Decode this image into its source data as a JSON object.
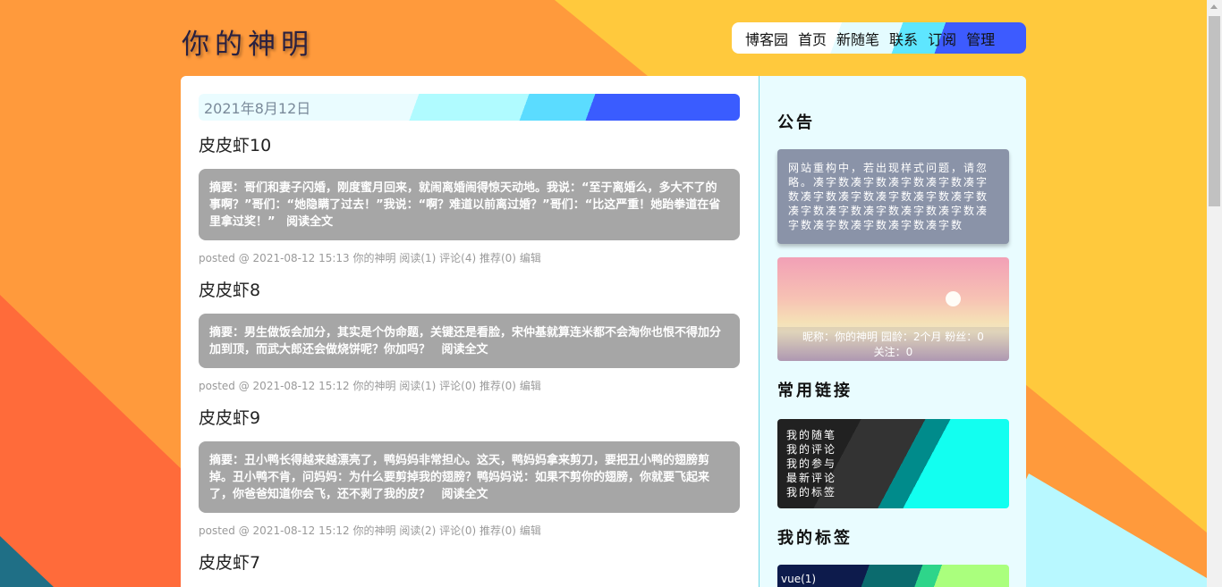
{
  "site": {
    "title": "你的神明"
  },
  "nav": {
    "items": [
      {
        "label": "博客园"
      },
      {
        "label": "首页"
      },
      {
        "label": "新随笔"
      },
      {
        "label": "联系"
      },
      {
        "label": "订阅"
      },
      {
        "label": "管理"
      }
    ]
  },
  "main": {
    "date": "2021年8月12日",
    "read_more_label": "阅读全文",
    "posts": [
      {
        "title": "皮皮虾10",
        "summary": "摘要：哥们和妻子闪婚，刚度蜜月回来，就闹离婚闹得惊天动地。我说：“至于离婚么，多大不了的事啊？”哥们：“她隐瞒了过去！”我说：“啊？难道以前离过婚？”哥们：“比这严重！她跆拳道在省里拿过奖！”",
        "footer_prefix": "posted @ 2021-08-12 15:13 你的神明",
        "reads": "阅读(1)",
        "comments": "评论(4)",
        "recommend": "推荐(0)",
        "edit": "编辑"
      },
      {
        "title": "皮皮虾8",
        "summary": "摘要：男生做饭会加分，其实是个伪命题，关键还是看脸，宋仲基就算连米都不会淘你也恨不得加分加到顶，而武大郎还会做烧饼呢？你加吗？",
        "footer_prefix": "posted @ 2021-08-12 15:12 你的神明",
        "reads": "阅读(1)",
        "comments": "评论(0)",
        "recommend": "推荐(0)",
        "edit": "编辑"
      },
      {
        "title": "皮皮虾9",
        "summary": "摘要：丑小鸭长得越来越漂亮了，鸭妈妈非常担心。这天，鸭妈妈拿来剪刀，要把丑小鸭的翅膀剪掉。丑小鸭不肯，问妈妈：为什么要剪掉我的翅膀？鸭妈妈说：如果不剪你的翅膀，你就要飞起来了，你爸爸知道你会飞，还不剥了我的皮？",
        "footer_prefix": "posted @ 2021-08-12 15:12 你的神明",
        "reads": "阅读(2)",
        "comments": "评论(0)",
        "recommend": "推荐(0)",
        "edit": "编辑"
      }
    ],
    "next_post_title": "皮皮虾7"
  },
  "sidebar": {
    "notice_heading": "公告",
    "notice_text": "网站重构中，若出现样式问题，请忽略。凑字数凑字数凑字数凑字数凑字数凑字数凑字数凑字数凑字数凑字数凑字数凑字数凑字数凑字数凑字数凑字数凑字数凑字数凑字数凑字数",
    "profile_line1": "昵称：你的神明   园龄：2个月   粉丝：0",
    "profile_line2": "关注：0",
    "links_heading": "常用链接",
    "links": [
      {
        "label": "我的随笔"
      },
      {
        "label": "我的评论"
      },
      {
        "label": "我的参与"
      },
      {
        "label": "最新评论"
      },
      {
        "label": "我的标签"
      }
    ],
    "tags_heading": "我的标签",
    "tags": [
      {
        "label": "vue(1)"
      }
    ]
  }
}
